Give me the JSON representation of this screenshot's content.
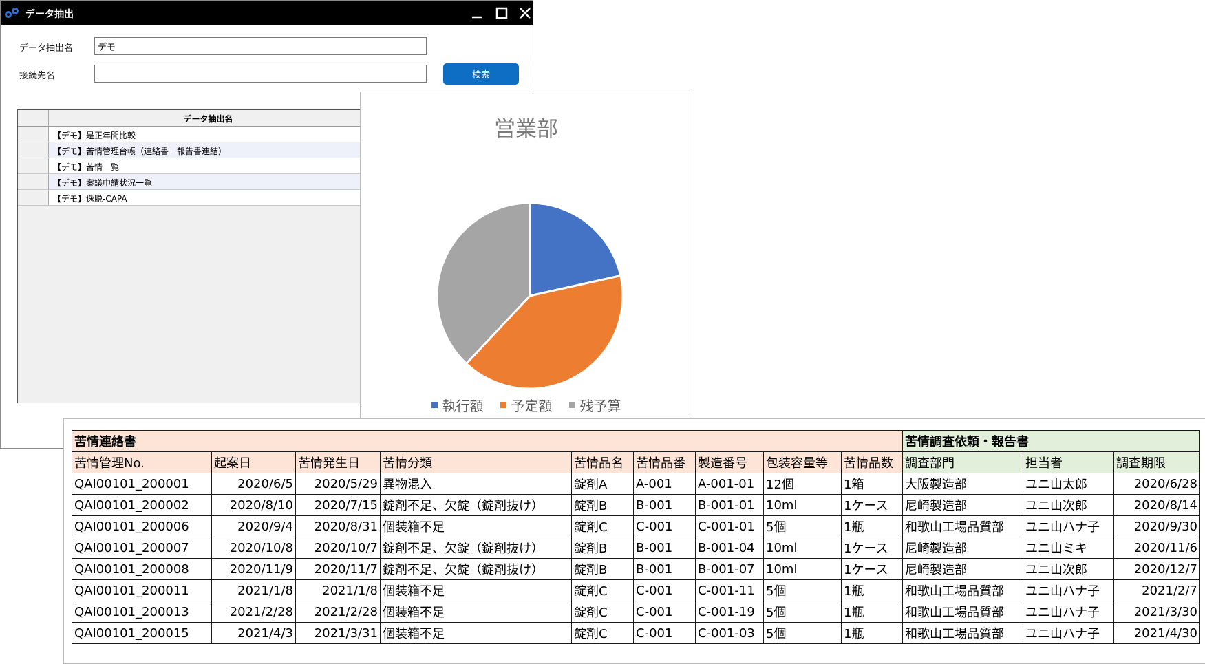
{
  "window": {
    "title": "データ抽出",
    "form": {
      "extraction_name_label": "データ抽出名",
      "extraction_name_value": "デモ",
      "connection_label": "接続先名",
      "connection_value": "",
      "search_label": "検索"
    },
    "grid": {
      "header": "データ抽出名",
      "rows": [
        "【デモ】是正年間比較",
        "【デモ】苦情管理台帳（連絡書－報告書連結）",
        "【デモ】苦情一覧",
        "【デモ】案議申請状況一覧",
        "【デモ】逸脱-CAPA"
      ]
    }
  },
  "chart_data": {
    "type": "pie",
    "title": "営業部",
    "categories": [
      "執行額",
      "予定額",
      "残予算"
    ],
    "values": [
      21.5,
      40.5,
      38.0
    ],
    "colors": [
      "#4472c4",
      "#ed7d31",
      "#a5a5a5"
    ],
    "legend_position": "bottom"
  },
  "table": {
    "group_complaint": "苦情連絡書",
    "group_investigation": "苦情調査依頼・報告書",
    "headers": [
      "苦情管理No.",
      "起案日",
      "苦情発生日",
      "苦情分類",
      "苦情品名",
      "苦情品番",
      "製造番号",
      "包装容量等",
      "苦情品数",
      "調査部門",
      "担当者",
      "調査期限"
    ],
    "rows": [
      [
        "QAI00101_200001",
        "2020/6/5",
        "2020/5/29",
        "異物混入",
        "錠剤A",
        "A-001",
        "A-001-01",
        "12個",
        "1箱",
        "大阪製造部",
        "ユニ山太郎",
        "2020/6/28"
      ],
      [
        "QAI00101_200002",
        "2020/8/10",
        "2020/7/15",
        "錠剤不足、欠錠（錠剤抜け）",
        "錠剤B",
        "B-001",
        "B-001-01",
        "10ml",
        "1ケース",
        "尼崎製造部",
        "ユニ山次郎",
        "2020/8/14"
      ],
      [
        "QAI00101_200006",
        "2020/9/4",
        "2020/8/31",
        "個装箱不足",
        "錠剤C",
        "C-001",
        "C-001-01",
        "5個",
        "1瓶",
        "和歌山工場品質部",
        "ユニ山ハナ子",
        "2020/9/30"
      ],
      [
        "QAI00101_200007",
        "2020/10/8",
        "2020/10/7",
        "錠剤不足、欠錠（錠剤抜け）",
        "錠剤B",
        "B-001",
        "B-001-04",
        "10ml",
        "1ケース",
        "尼崎製造部",
        "ユニ山ミキ",
        "2020/11/6"
      ],
      [
        "QAI00101_200008",
        "2020/11/9",
        "2020/11/7",
        "錠剤不足、欠錠（錠剤抜け）",
        "錠剤B",
        "B-001",
        "B-001-07",
        "10ml",
        "1ケース",
        "尼崎製造部",
        "ユニ山次郎",
        "2020/12/7"
      ],
      [
        "QAI00101_200011",
        "2021/1/8",
        "2021/1/8",
        "個装箱不足",
        "錠剤C",
        "C-001",
        "C-001-11",
        "5個",
        "1瓶",
        "和歌山工場品質部",
        "ユニ山ハナ子",
        "2021/2/7"
      ],
      [
        "QAI00101_200013",
        "2021/2/28",
        "2021/2/28",
        "個装箱不足",
        "錠剤C",
        "C-001",
        "C-001-19",
        "5個",
        "1瓶",
        "和歌山工場品質部",
        "ユニ山ハナ子",
        "2021/3/30"
      ],
      [
        "QAI00101_200015",
        "2021/4/3",
        "2021/3/31",
        "個装箱不足",
        "錠剤C",
        "C-001",
        "C-001-03",
        "5個",
        "1瓶",
        "和歌山工場品質部",
        "ユニ山ハナ子",
        "2021/4/30"
      ]
    ]
  }
}
